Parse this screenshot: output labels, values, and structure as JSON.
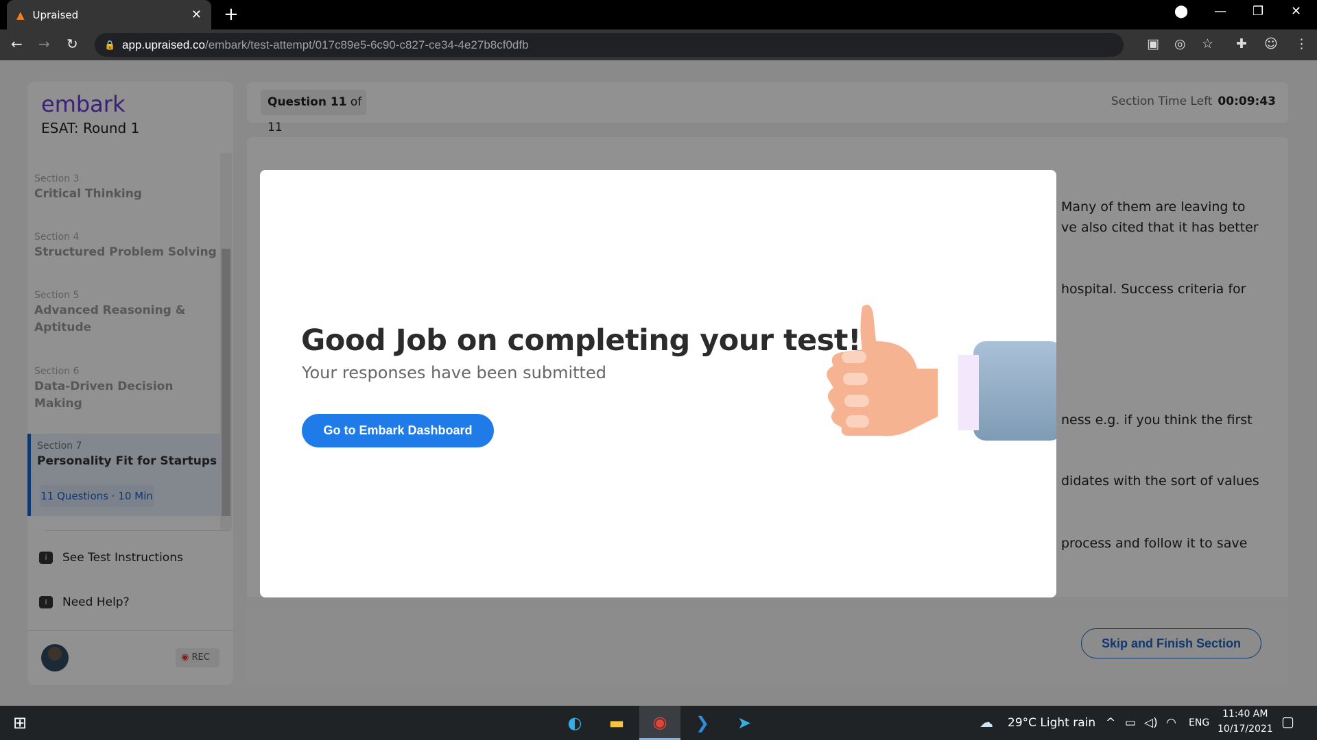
{
  "browser": {
    "tab_title": "Upraised",
    "url_host": "app.upraised.co",
    "url_path": "/embark/test-attempt/017c89e5-6c90-c827-ce34-4e27b8cf0dfb"
  },
  "sidebar": {
    "logo": "embark",
    "test_title": "ESAT: Round 1",
    "sections": [
      {
        "label": "Section 3",
        "name": "Critical Thinking"
      },
      {
        "label": "Section 4",
        "name": "Structured Problem Solving"
      },
      {
        "label": "Section 5",
        "name": "Advanced Reasoning & Aptitude"
      },
      {
        "label": "Section 6",
        "name": "Data-Driven Decision Making"
      }
    ],
    "active_section": {
      "label": "Section 7",
      "name": "Personality Fit for Startups",
      "meta": "11 Questions · 10 Min"
    },
    "instructions": "See Test Instructions",
    "help": "Need Help?",
    "rec": "REC"
  },
  "header": {
    "question_prefix": "Question 11",
    "question_suffix": "of 11",
    "time_label": "Section Time Left",
    "time_value": "00:09:43"
  },
  "question_fragments": [
    "Many of them are leaving to",
    "ve also cited that it has better",
    "hospital. Success criteria for",
    "ness e.g. if you think the first",
    "didates with the sort of values",
    "process and follow it to save"
  ],
  "footer": {
    "skip": "Skip and Finish Section"
  },
  "modal": {
    "title": "Good Job on completing your test!",
    "subtitle": "Your responses have been submitted",
    "button": "Go to Embark Dashboard"
  },
  "taskbar": {
    "weather": "29°C  Light rain",
    "lang": "ENG",
    "time": "11:40 AM",
    "date": "10/17/2021"
  },
  "colors": {
    "accent": "#1e7be8",
    "brand": "#6a35d8"
  }
}
